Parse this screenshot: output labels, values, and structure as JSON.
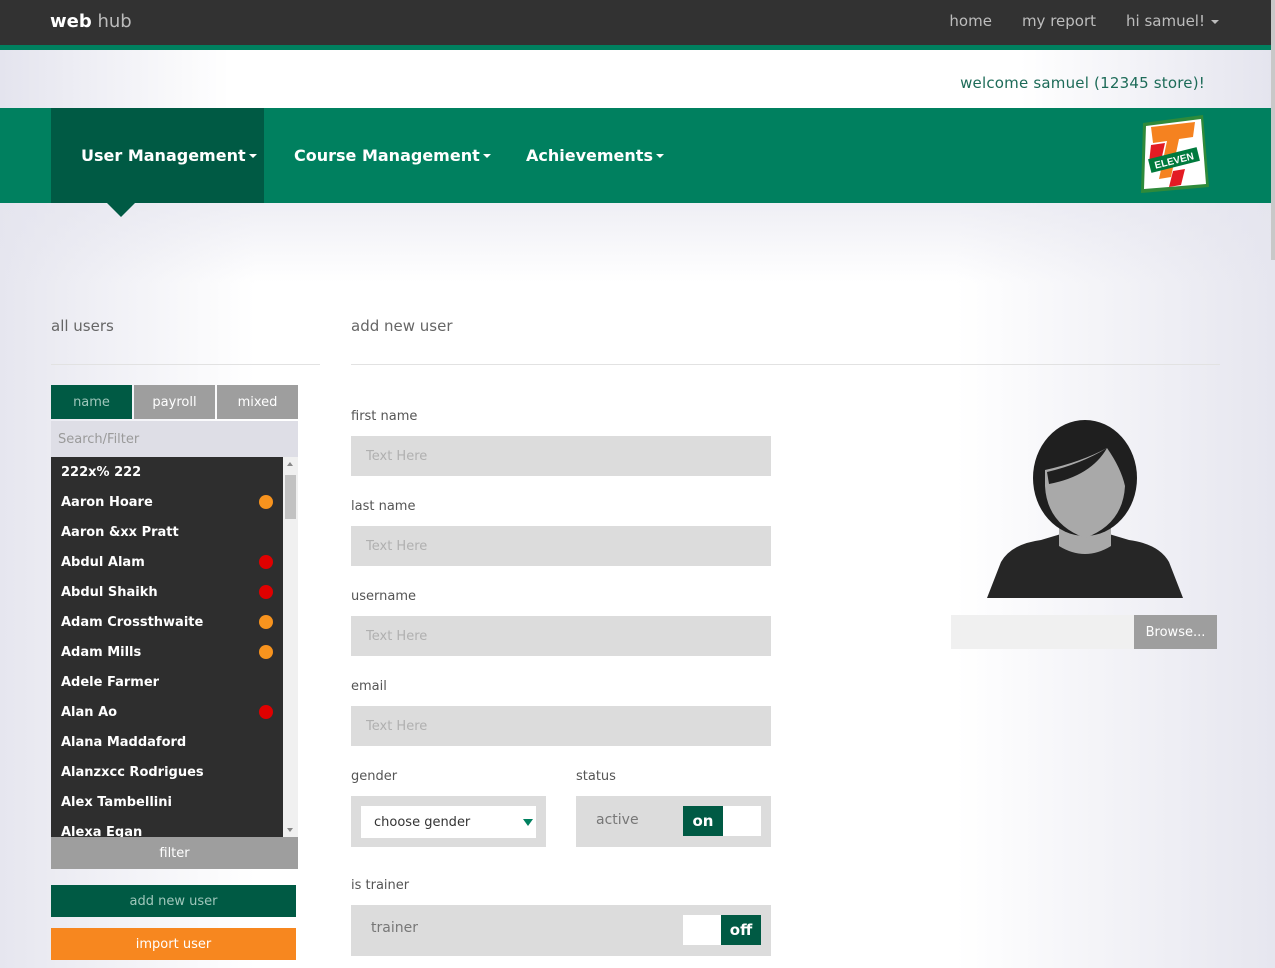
{
  "app": {
    "brand_bold": "web",
    "brand_light": "hub"
  },
  "topnav": {
    "home": "home",
    "report": "my report",
    "greeting": "hi samuel!"
  },
  "welcome": "welcome samuel (12345 store)!",
  "mainnav": {
    "items": [
      "User Management",
      "Course Management",
      "Achievements"
    ],
    "active": "User Management",
    "logo": "7-eleven-logo"
  },
  "users_panel": {
    "title": "all users",
    "tabs": [
      "name",
      "payroll",
      "mixed"
    ],
    "active_tab": "name",
    "search_placeholder": "Search/Filter",
    "users": [
      {
        "name": "222x% 222",
        "status": ""
      },
      {
        "name": "Aaron Hoare",
        "status": "orange"
      },
      {
        "name": "Aaron &xx Pratt",
        "status": ""
      },
      {
        "name": "Abdul Alam",
        "status": "red"
      },
      {
        "name": "Abdul Shaikh",
        "status": "red"
      },
      {
        "name": "Adam Crossthwaite",
        "status": "orange"
      },
      {
        "name": "Adam Mills",
        "status": "orange"
      },
      {
        "name": "Adele Farmer",
        "status": ""
      },
      {
        "name": "Alan Ao",
        "status": "red"
      },
      {
        "name": "Alana Maddaford",
        "status": ""
      },
      {
        "name": "Alanzxcc Rodrigues",
        "status": ""
      },
      {
        "name": "Alex Tambellini",
        "status": ""
      },
      {
        "name": "Alexa Egan",
        "status": ""
      }
    ],
    "filter_label": "filter",
    "add_label": "add new user",
    "import_label": "import user"
  },
  "form": {
    "title": "add new user",
    "first_name_label": "first name",
    "last_name_label": "last name",
    "username_label": "username",
    "email_label": "email",
    "placeholder": "Text Here",
    "gender_label": "gender",
    "gender_value": "choose gender",
    "status_label": "status",
    "status_text": "active",
    "status_toggle": "on",
    "trainer_label": "is trainer",
    "trainer_text": "trainer",
    "trainer_toggle": "off",
    "browse_label": "Browse..."
  },
  "colors": {
    "brand_green": "#00805f",
    "dark_green": "#005a44",
    "orange": "#f7871f",
    "status_orange": "#f7931e",
    "status_red": "#e00000",
    "list_bg": "#2e2e2e"
  }
}
